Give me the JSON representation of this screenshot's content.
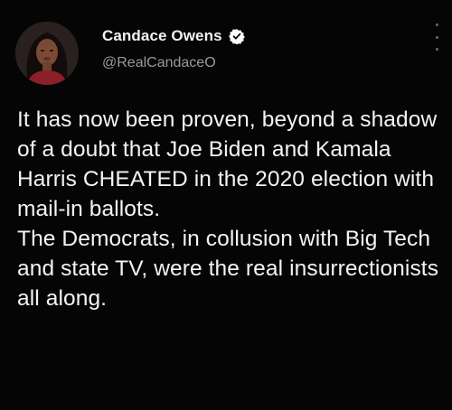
{
  "author": {
    "display_name": "Candace Owens",
    "handle": "@RealCandaceO",
    "verified": true,
    "avatar_icon": "profile-photo"
  },
  "tweet": {
    "paragraphs": [
      "It has now been proven, beyond a shadow of a doubt that Joe Biden and Kamala Harris CHEATED in the 2020 election with mail-in ballots.",
      "The Democrats, in collusion with Big Tech and state TV, were the real insurrectionists all along."
    ]
  },
  "colors": {
    "background": "#050505",
    "text": "#f3f3f3",
    "handle": "#9a9a9a",
    "verified_badge": "#ffffff"
  }
}
